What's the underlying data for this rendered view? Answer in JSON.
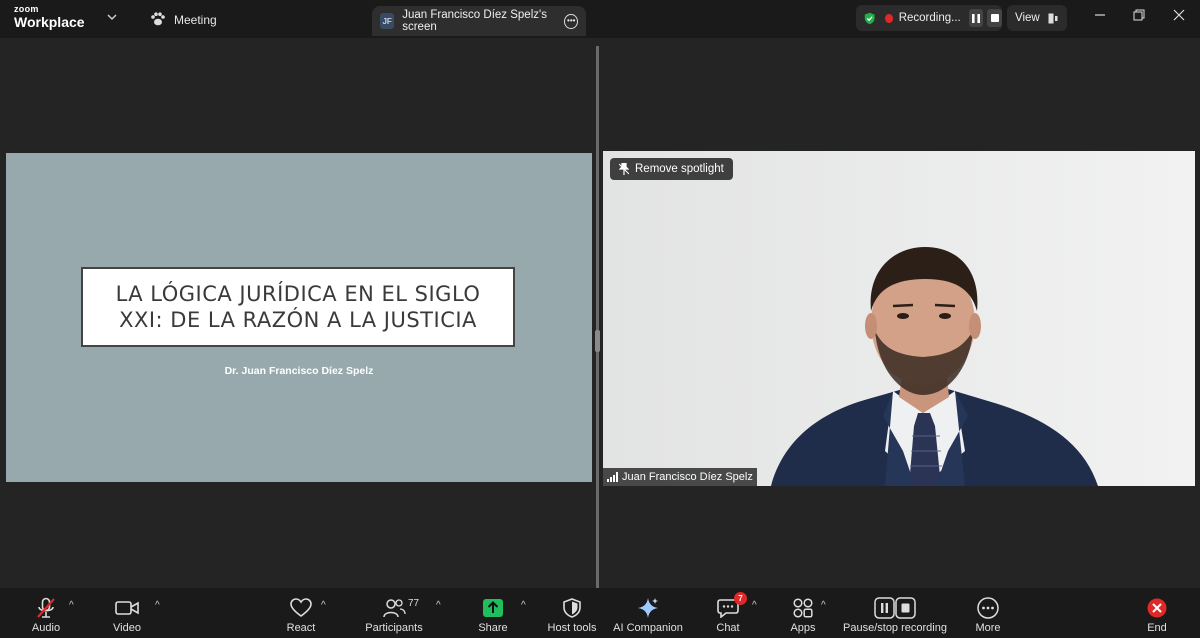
{
  "titlebar": {
    "brand_top": "zoom",
    "brand_bottom": "Workplace",
    "meeting_tab": "Meeting",
    "screen_tab_initials": "JF",
    "screen_tab_label": "Juan Francisco Díez Spelz's screen",
    "recording_label": "Recording...",
    "view_label": "View"
  },
  "slide": {
    "title_line1": "LA LÓGICA JURÍDICA EN EL SIGLO",
    "title_line2": "XXI: DE LA RAZÓN A LA JUSTICIA",
    "subtitle": "Dr. Juan Francisco Díez Spelz"
  },
  "video": {
    "spotlight_button": "Remove spotlight",
    "participant_name": "Juan Francisco Díez Spelz"
  },
  "toolbar": {
    "audio": "Audio",
    "video": "Video",
    "react": "React",
    "participants": "Participants",
    "participants_count": "77",
    "share": "Share",
    "host_tools": "Host tools",
    "ai_companion": "AI Companion",
    "chat": "Chat",
    "chat_badge": "7",
    "apps": "Apps",
    "pause_stop": "Pause/stop recording",
    "more": "More",
    "end": "End"
  },
  "colors": {
    "share_green": "#1fbf5e",
    "end_red": "#e02828",
    "slide_bg": "#98a9ad",
    "ai_blue": "#9fc9ff"
  }
}
